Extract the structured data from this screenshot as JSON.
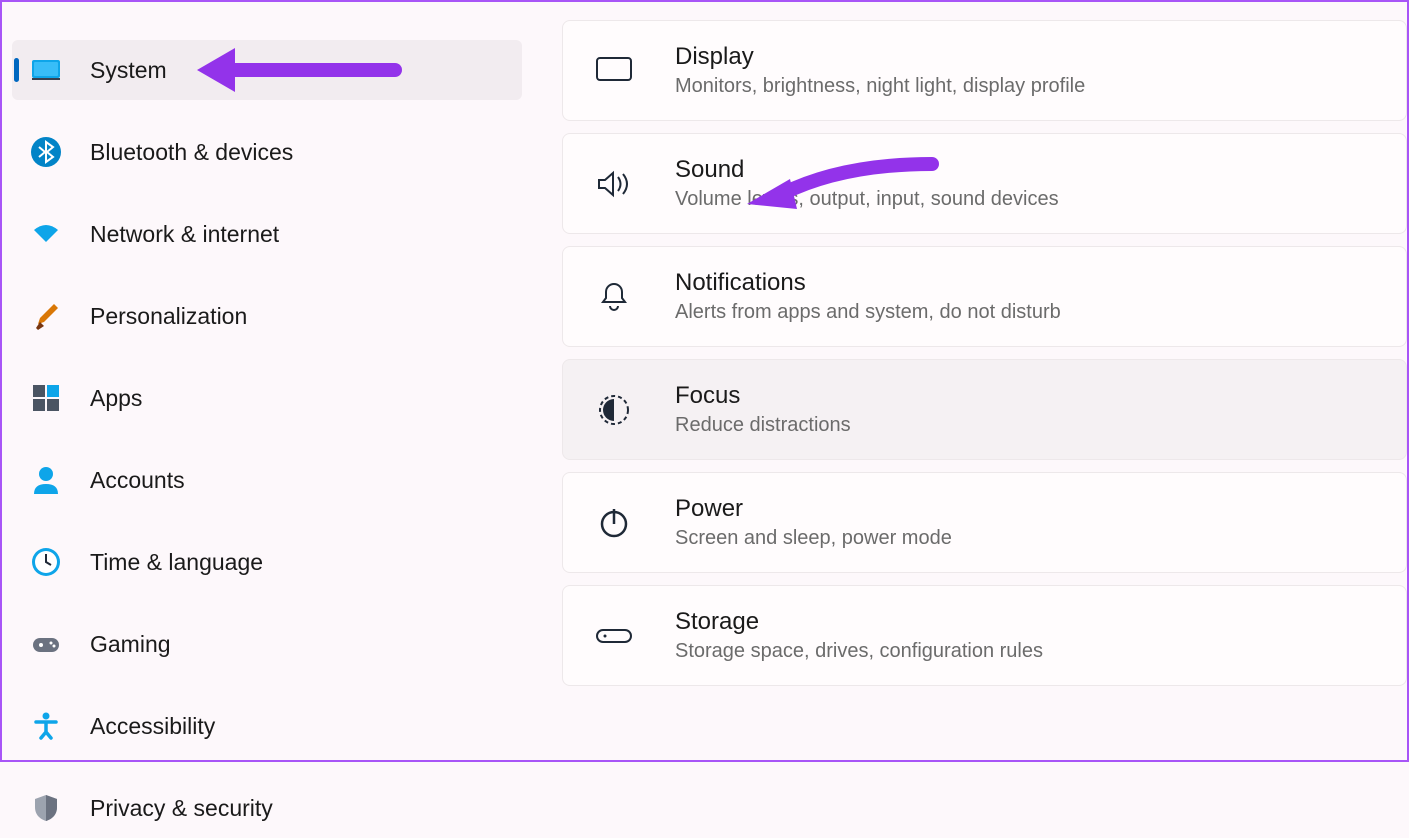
{
  "sidebar": {
    "items": [
      {
        "label": "System",
        "icon": "system-icon",
        "active": true
      },
      {
        "label": "Bluetooth & devices",
        "icon": "bluetooth-icon",
        "active": false
      },
      {
        "label": "Network & internet",
        "icon": "wifi-icon",
        "active": false
      },
      {
        "label": "Personalization",
        "icon": "paintbrush-icon",
        "active": false
      },
      {
        "label": "Apps",
        "icon": "apps-icon",
        "active": false
      },
      {
        "label": "Accounts",
        "icon": "person-icon",
        "active": false
      },
      {
        "label": "Time & language",
        "icon": "clock-icon",
        "active": false
      },
      {
        "label": "Gaming",
        "icon": "gamepad-icon",
        "active": false
      },
      {
        "label": "Accessibility",
        "icon": "accessibility-icon",
        "active": false
      },
      {
        "label": "Privacy & security",
        "icon": "shield-icon",
        "active": false
      }
    ]
  },
  "main": {
    "cards": [
      {
        "title": "Display",
        "desc": "Monitors, brightness, night light, display profile",
        "icon": "display-icon",
        "highlighted": false
      },
      {
        "title": "Sound",
        "desc": "Volume levels, output, input, sound devices",
        "icon": "sound-icon",
        "highlighted": false
      },
      {
        "title": "Notifications",
        "desc": "Alerts from apps and system, do not disturb",
        "icon": "notifications-icon",
        "highlighted": false
      },
      {
        "title": "Focus",
        "desc": "Reduce distractions",
        "icon": "focus-icon",
        "highlighted": true
      },
      {
        "title": "Power",
        "desc": "Screen and sleep, power mode",
        "icon": "power-icon",
        "highlighted": false
      },
      {
        "title": "Storage",
        "desc": "Storage space, drives, configuration rules",
        "icon": "storage-icon",
        "highlighted": false
      }
    ]
  },
  "annotations": {
    "arrow_color": "#9333ea"
  }
}
